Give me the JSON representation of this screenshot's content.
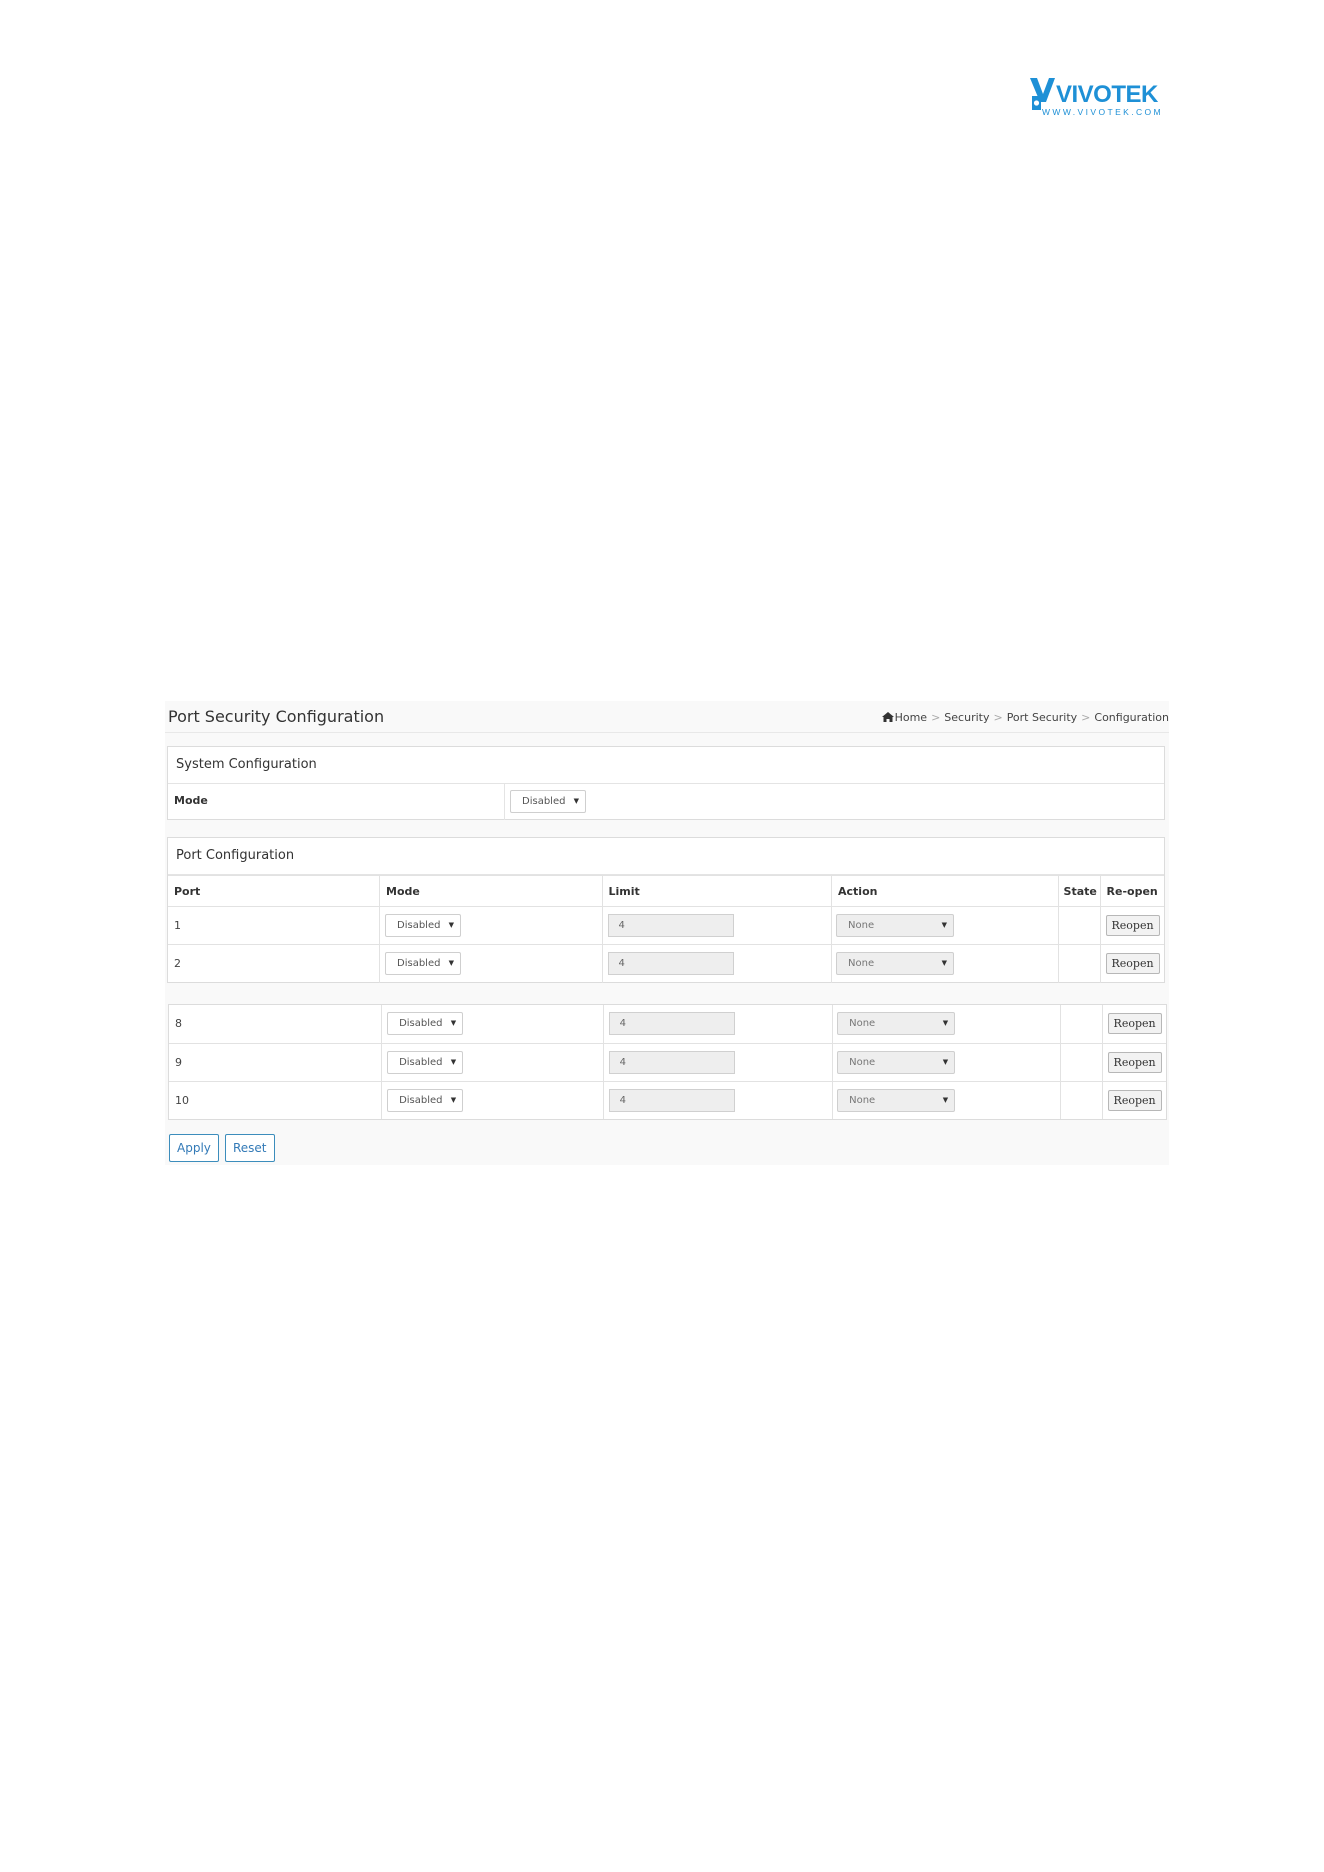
{
  "brand": {
    "name": "VIVOTEK",
    "url_text": "WWW.VIVOTEK.COM"
  },
  "header": {
    "title": "Port Security Configuration",
    "breadcrumb": [
      "Home",
      "Security",
      "Port Security",
      "Configuration"
    ]
  },
  "system": {
    "title": "System Configuration",
    "mode_label": "Mode",
    "mode_value": "Disabled"
  },
  "port_config": {
    "title": "Port Configuration",
    "columns": [
      "Port",
      "Mode",
      "Limit",
      "Action",
      "State",
      "Re-open"
    ],
    "rows": [
      {
        "port": "1",
        "mode": "Disabled",
        "limit": "4",
        "action": "None",
        "state": "",
        "reopen": "Reopen"
      },
      {
        "port": "2",
        "mode": "Disabled",
        "limit": "4",
        "action": "None",
        "state": "",
        "reopen": "Reopen"
      }
    ],
    "rows_continued": [
      {
        "port": "8",
        "mode": "Disabled",
        "limit": "4",
        "action": "None",
        "state": "",
        "reopen": "Reopen"
      },
      {
        "port": "9",
        "mode": "Disabled",
        "limit": "4",
        "action": "None",
        "state": "",
        "reopen": "Reopen"
      },
      {
        "port": "10",
        "mode": "Disabled",
        "limit": "4",
        "action": "None",
        "state": "",
        "reopen": "Reopen"
      }
    ]
  },
  "buttons": {
    "apply": "Apply",
    "reset": "Reset"
  },
  "colors": {
    "brand_blue": "#1e90d6",
    "button_blue": "#337ab7"
  },
  "icons": {
    "home": "home-icon",
    "caret": "caret-down-icon"
  }
}
